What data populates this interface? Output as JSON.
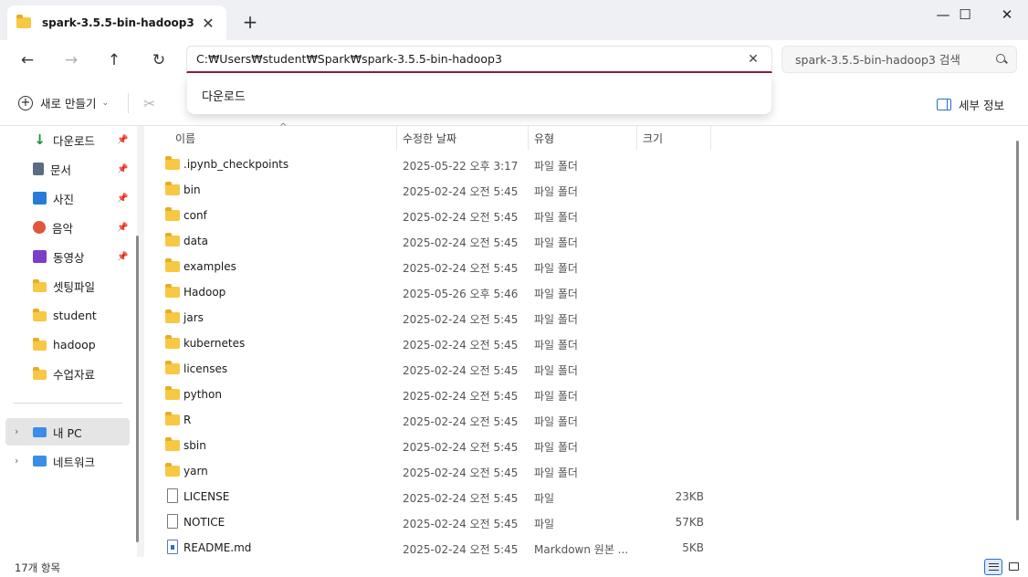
{
  "window": {
    "tab_title": "spark-3.5.5-bin-hadoop3",
    "tab_close": "✕",
    "new_tab": "+",
    "minimize": "—",
    "maximize": "☐",
    "close": "✕"
  },
  "nav": {
    "back": "←",
    "forward": "→",
    "up": "↑",
    "refresh": "↻",
    "address_value": "C:₩Users₩student₩Spark₩spark-3.5.5-bin-hadoop3",
    "address_clear": "✕",
    "search_placeholder": "spark-3.5.5-bin-hadoop3 검색",
    "suggestion": "다운로드"
  },
  "commandbar": {
    "new_label": "새로 만들기",
    "new_chevron": "⌄",
    "cut_icon": "✂",
    "details_label": "세부 정보"
  },
  "sidebar": {
    "quick_access": [
      {
        "label": "다운로드",
        "icon": "download-icon",
        "pinned": true
      },
      {
        "label": "문서",
        "icon": "document-icon",
        "pinned": true
      },
      {
        "label": "사진",
        "icon": "picture-icon",
        "pinned": true
      },
      {
        "label": "음악",
        "icon": "music-icon",
        "pinned": true
      },
      {
        "label": "동영상",
        "icon": "video-icon",
        "pinned": true
      },
      {
        "label": "셋팅파일",
        "icon": "folder-icon",
        "pinned": false
      },
      {
        "label": "student",
        "icon": "folder-icon",
        "pinned": false
      },
      {
        "label": "hadoop",
        "icon": "folder-icon",
        "pinned": false
      },
      {
        "label": "수업자료",
        "icon": "folder-icon",
        "pinned": false
      }
    ],
    "this_pc": "내 PC",
    "network": "네트워크",
    "pin_glyph": "📌",
    "expander": "›"
  },
  "columns": {
    "name": "이름",
    "modified": "수정한 날짜",
    "type": "유형",
    "size": "크기",
    "sort_arrow": "^"
  },
  "files": [
    {
      "name": ".ipynb_checkpoints",
      "date": "2025-05-22 오후 3:17",
      "type": "파일 폴더",
      "size": "",
      "kind": "folder"
    },
    {
      "name": "bin",
      "date": "2025-02-24 오전 5:45",
      "type": "파일 폴더",
      "size": "",
      "kind": "folder"
    },
    {
      "name": "conf",
      "date": "2025-02-24 오전 5:45",
      "type": "파일 폴더",
      "size": "",
      "kind": "folder"
    },
    {
      "name": "data",
      "date": "2025-02-24 오전 5:45",
      "type": "파일 폴더",
      "size": "",
      "kind": "folder"
    },
    {
      "name": "examples",
      "date": "2025-02-24 오전 5:45",
      "type": "파일 폴더",
      "size": "",
      "kind": "folder"
    },
    {
      "name": "Hadoop",
      "date": "2025-05-26 오후 5:46",
      "type": "파일 폴더",
      "size": "",
      "kind": "folder"
    },
    {
      "name": "jars",
      "date": "2025-02-24 오전 5:45",
      "type": "파일 폴더",
      "size": "",
      "kind": "folder"
    },
    {
      "name": "kubernetes",
      "date": "2025-02-24 오전 5:45",
      "type": "파일 폴더",
      "size": "",
      "kind": "folder"
    },
    {
      "name": "licenses",
      "date": "2025-02-24 오전 5:45",
      "type": "파일 폴더",
      "size": "",
      "kind": "folder"
    },
    {
      "name": "python",
      "date": "2025-02-24 오전 5:45",
      "type": "파일 폴더",
      "size": "",
      "kind": "folder"
    },
    {
      "name": "R",
      "date": "2025-02-24 오전 5:45",
      "type": "파일 폴더",
      "size": "",
      "kind": "folder"
    },
    {
      "name": "sbin",
      "date": "2025-02-24 오전 5:45",
      "type": "파일 폴더",
      "size": "",
      "kind": "folder"
    },
    {
      "name": "yarn",
      "date": "2025-02-24 오전 5:45",
      "type": "파일 폴더",
      "size": "",
      "kind": "folder"
    },
    {
      "name": "LICENSE",
      "date": "2025-02-24 오전 5:45",
      "type": "파일",
      "size": "23KB",
      "kind": "file"
    },
    {
      "name": "NOTICE",
      "date": "2025-02-24 오전 5:45",
      "type": "파일",
      "size": "57KB",
      "kind": "file"
    },
    {
      "name": "README.md",
      "date": "2025-02-24 오전 5:45",
      "type": "Markdown 원본 ...",
      "size": "5KB",
      "kind": "markdown"
    }
  ],
  "status": {
    "item_count": "17개 항목"
  },
  "colors": {
    "accent": "#8b1d3c",
    "folder": "#f7c843",
    "selection": "#e5e5e5"
  }
}
